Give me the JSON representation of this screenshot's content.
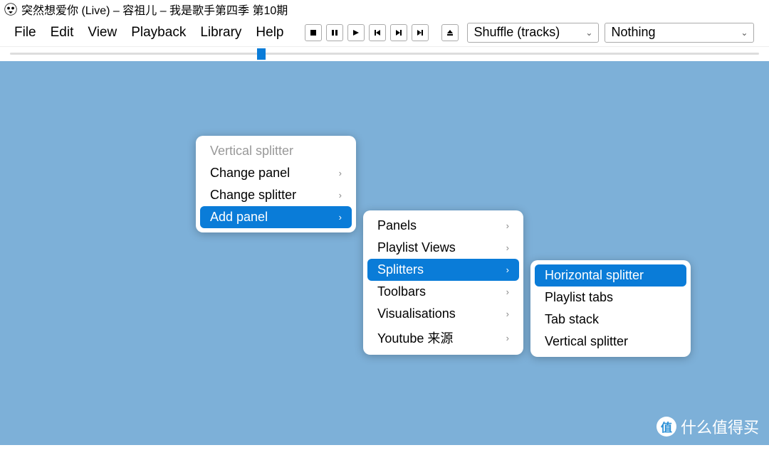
{
  "title": "突然想爱你 (Live) – 容祖儿 – 我是歌手第四季 第10期",
  "menubar": [
    "File",
    "Edit",
    "View",
    "Playback",
    "Library",
    "Help"
  ],
  "dropdowns": {
    "shuffle": "Shuffle (tracks)",
    "order": "Nothing"
  },
  "seek": {
    "position_pct": 33
  },
  "context_menu_1": {
    "header": "Vertical splitter",
    "items": [
      {
        "label": "Change panel",
        "submenu": true,
        "highlight": false
      },
      {
        "label": "Change splitter",
        "submenu": true,
        "highlight": false
      },
      {
        "label": "Add panel",
        "submenu": true,
        "highlight": true
      }
    ]
  },
  "context_menu_2": {
    "items": [
      {
        "label": "Panels",
        "submenu": true,
        "highlight": false
      },
      {
        "label": "Playlist Views",
        "submenu": true,
        "highlight": false
      },
      {
        "label": "Splitters",
        "submenu": true,
        "highlight": true
      },
      {
        "label": "Toolbars",
        "submenu": true,
        "highlight": false
      },
      {
        "label": "Visualisations",
        "submenu": true,
        "highlight": false
      },
      {
        "label": "Youtube 来源",
        "submenu": true,
        "highlight": false
      }
    ]
  },
  "context_menu_3": {
    "items": [
      {
        "label": "Horizontal splitter",
        "submenu": false,
        "highlight": true
      },
      {
        "label": "Playlist tabs",
        "submenu": false,
        "highlight": false
      },
      {
        "label": "Tab stack",
        "submenu": false,
        "highlight": false
      },
      {
        "label": "Vertical splitter",
        "submenu": false,
        "highlight": false
      }
    ]
  },
  "watermark": "什么值得买",
  "watermark_badge": "值"
}
